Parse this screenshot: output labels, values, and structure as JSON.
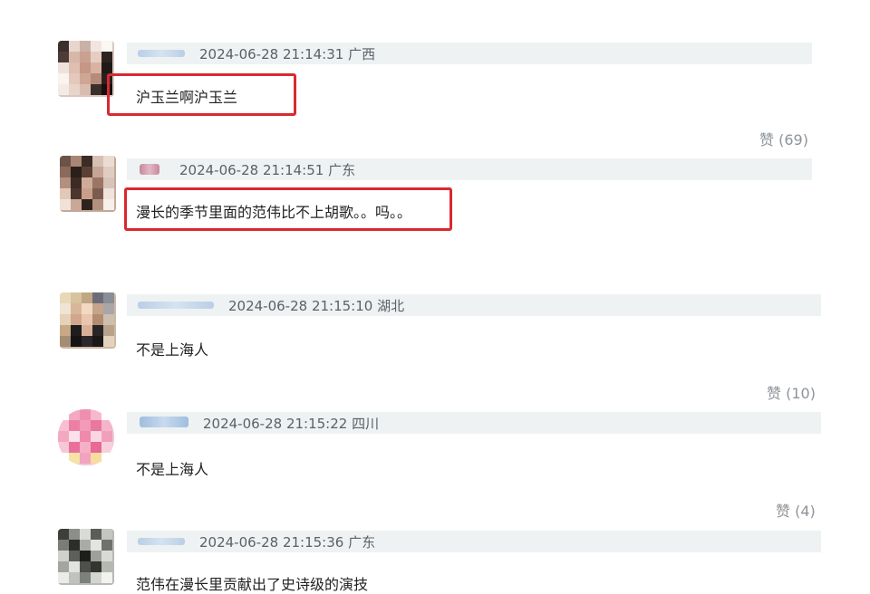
{
  "comments": [
    {
      "timestamp": "2024-06-28 21:14:31",
      "location": "广西",
      "text": "沪玉兰啊沪玉兰",
      "likes": "赞 (69)",
      "highlighted": true
    },
    {
      "timestamp": "2024-06-28 21:14:51",
      "location": "广东",
      "text": "漫长的季节里面的范伟比不上胡歌。。吗。。",
      "likes": "",
      "highlighted": true
    },
    {
      "timestamp": "2024-06-28 21:15:10",
      "location": "湖北",
      "text": "不是上海人",
      "likes": "赞 (10)",
      "highlighted": false
    },
    {
      "timestamp": "2024-06-28 21:15:22",
      "location": "四川",
      "text": "不是上海人",
      "likes": "赞 (4)",
      "highlighted": false
    },
    {
      "timestamp": "2024-06-28 21:15:36",
      "location": "广东",
      "text": "范伟在漫长里贡献出了史诗级的演技",
      "likes": "",
      "highlighted": false
    }
  ]
}
